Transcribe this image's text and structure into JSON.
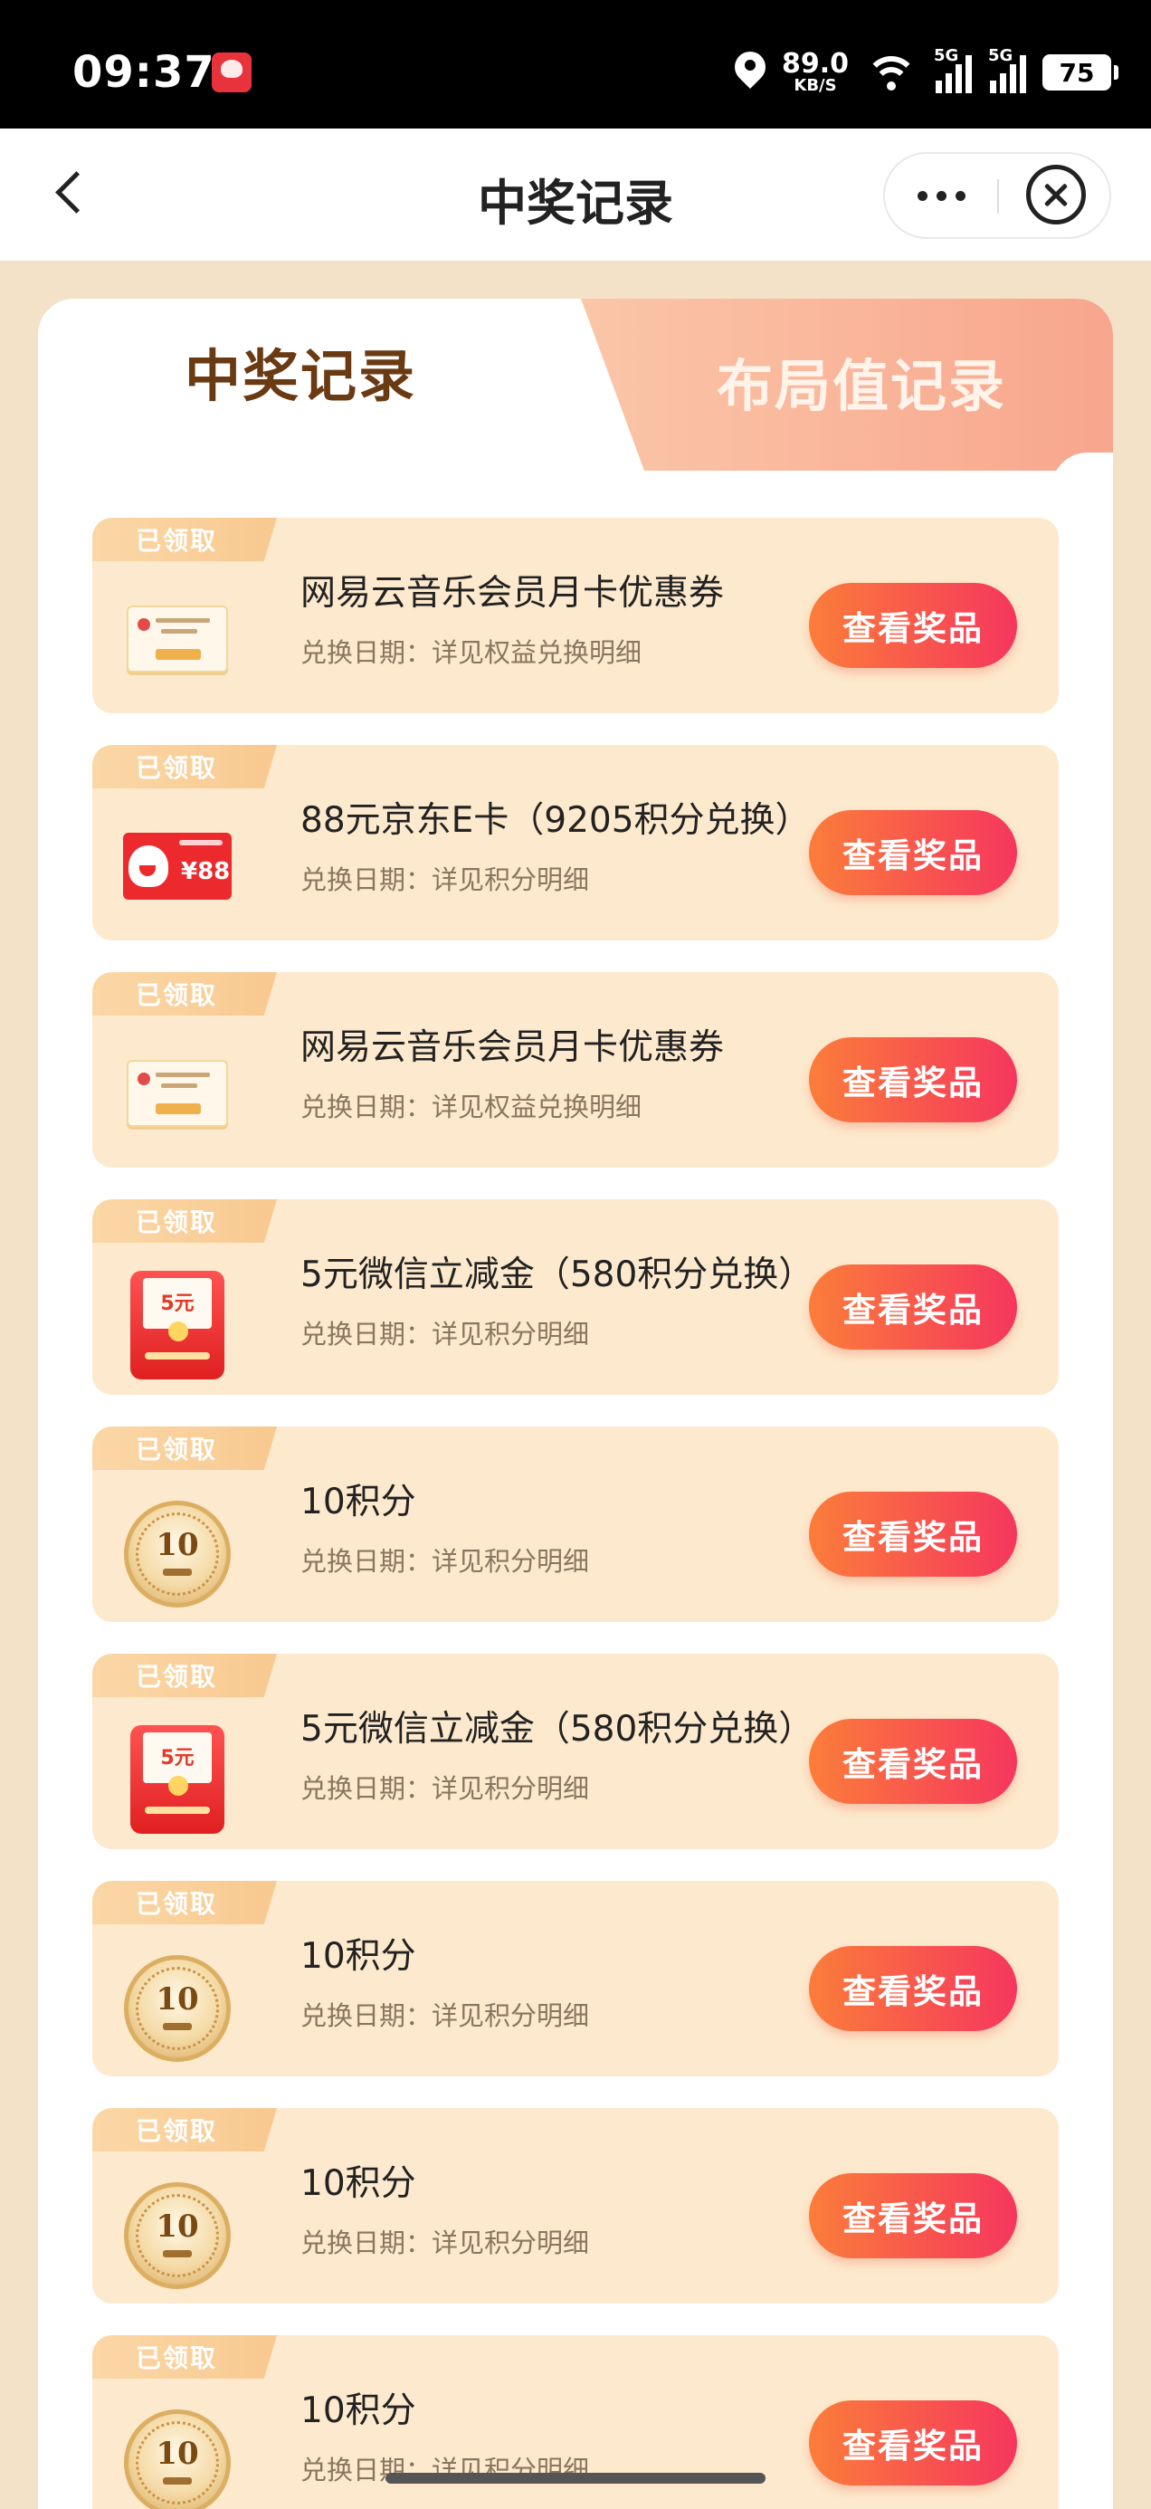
{
  "status_bar": {
    "time": "09:37",
    "net_speed_value": "89.0",
    "net_speed_unit": "KB/S",
    "sig1_label": "5G",
    "sig2_label": "5G",
    "battery": "75"
  },
  "nav": {
    "title": "中奖记录"
  },
  "tabs": {
    "active": "中奖记录",
    "inactive": "布局值记录"
  },
  "items": [
    {
      "status": "已领取",
      "thumb": "music-coupon",
      "title": "网易云音乐会员月卡优惠券",
      "subtitle": "兑换日期：详见权益兑换明细",
      "button": "查看奖品"
    },
    {
      "status": "已领取",
      "thumb": "jd-card",
      "thumb_value": "¥88",
      "title": "88元京东E卡（9205积分兑换）",
      "subtitle": "兑换日期：详见积分明细",
      "button": "查看奖品"
    },
    {
      "status": "已领取",
      "thumb": "music-coupon",
      "title": "网易云音乐会员月卡优惠券",
      "subtitle": "兑换日期：详见权益兑换明细",
      "button": "查看奖品"
    },
    {
      "status": "已领取",
      "thumb": "red-envelope",
      "thumb_value": "5元",
      "title": "5元微信立减金（580积分兑换）",
      "subtitle": "兑换日期：详见积分明细",
      "button": "查看奖品"
    },
    {
      "status": "已领取",
      "thumb": "points-coin",
      "thumb_value": "10",
      "title": "10积分",
      "subtitle": "兑换日期：详见积分明细",
      "button": "查看奖品"
    },
    {
      "status": "已领取",
      "thumb": "red-envelope",
      "thumb_value": "5元",
      "title": "5元微信立减金（580积分兑换）",
      "subtitle": "兑换日期：详见积分明细",
      "button": "查看奖品"
    },
    {
      "status": "已领取",
      "thumb": "points-coin",
      "thumb_value": "10",
      "title": "10积分",
      "subtitle": "兑换日期：详见积分明细",
      "button": "查看奖品"
    },
    {
      "status": "已领取",
      "thumb": "points-coin",
      "thumb_value": "10",
      "title": "10积分",
      "subtitle": "兑换日期：详见积分明细",
      "button": "查看奖品"
    },
    {
      "status": "已领取",
      "thumb": "points-coin",
      "thumb_value": "10",
      "title": "10积分",
      "subtitle": "兑换日期：详见积分明细",
      "button": "查看奖品"
    }
  ],
  "colors": {
    "page_bg": "#f3e2c8",
    "card_bg": "#fde9cd",
    "button_from": "#fb7d3a",
    "button_to": "#f6365e",
    "active_tab_text": "#6a3a12"
  }
}
